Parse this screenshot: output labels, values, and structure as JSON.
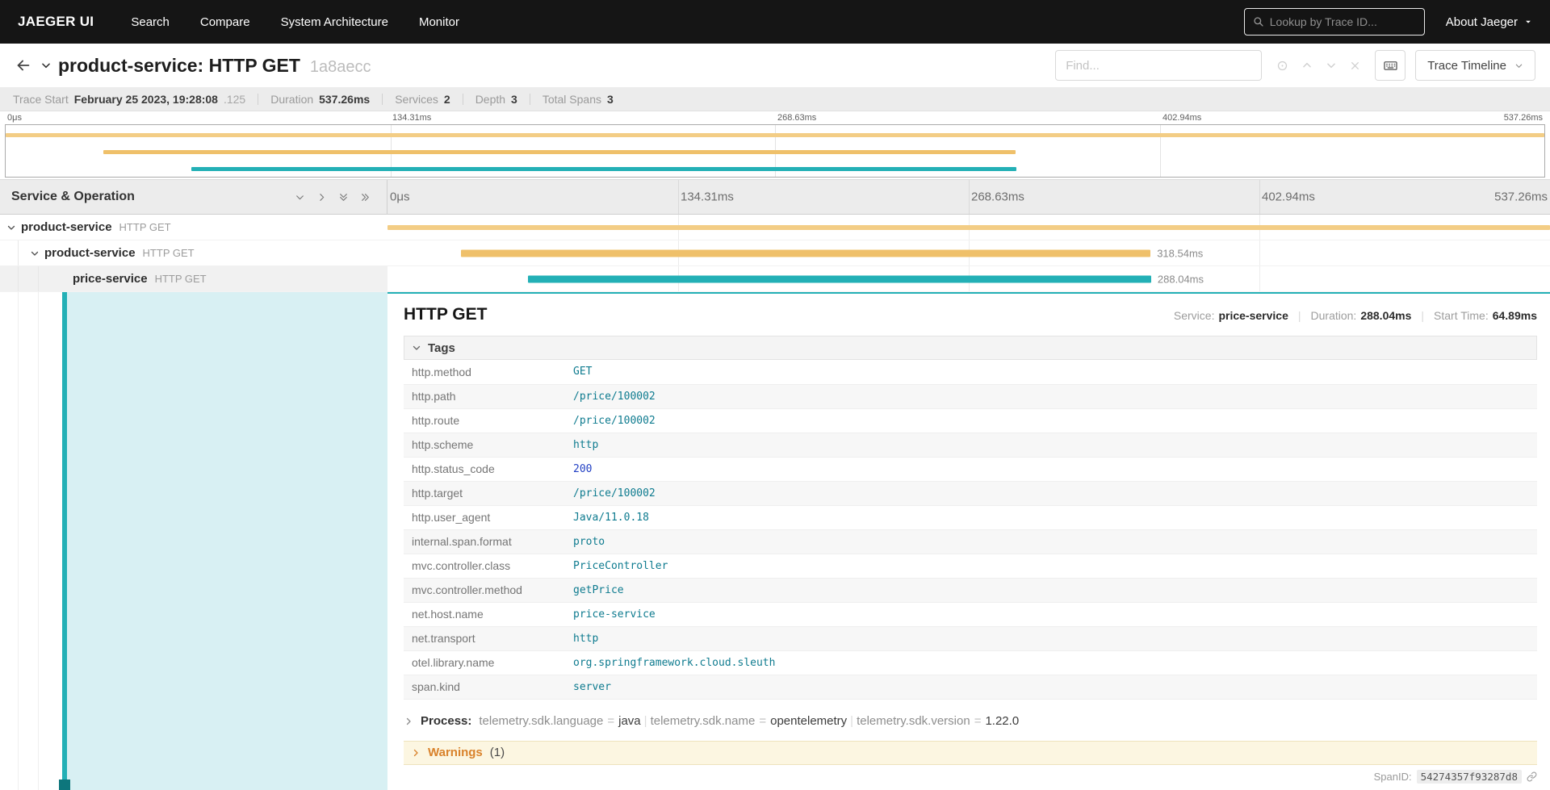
{
  "nav": {
    "brand": "JAEGER UI",
    "items": [
      "Search",
      "Compare",
      "System Architecture",
      "Monitor"
    ],
    "lookup_placeholder": "Lookup by Trace ID...",
    "about_label": "About Jaeger"
  },
  "header": {
    "title": "product-service: HTTP GET",
    "trace_short_id": "1a8aecc",
    "find_placeholder": "Find...",
    "view_label": "Trace Timeline"
  },
  "summary": [
    {
      "label": "Trace Start",
      "value": "February 25 2023, 19:28:08",
      "suffix": ".125"
    },
    {
      "label": "Duration",
      "value": "537.26ms"
    },
    {
      "label": "Services",
      "value": "2"
    },
    {
      "label": "Depth",
      "value": "3"
    },
    {
      "label": "Total Spans",
      "value": "3"
    }
  ],
  "timeline": {
    "left_header": "Service & Operation",
    "ticks": [
      "0μs",
      "134.31ms",
      "268.63ms",
      "402.94ms",
      "537.26ms"
    ]
  },
  "colors": {
    "accent": "#23b0b6",
    "accent_light": "#d8f0f3",
    "accent_dark": "#0d767c",
    "span_root": "#f3cd85",
    "span_product": "#efc06a",
    "span_price": "#23b0b6",
    "warning": "#d9822b",
    "tag_string": "#0e7b8f",
    "tag_number": "#2240c4"
  },
  "spans": [
    {
      "service": "product-service",
      "operation": "HTTP GET",
      "depth": 0,
      "has_children": true,
      "start_pct": 0,
      "width_pct": 100,
      "duration_label": "",
      "color": "span_root",
      "selected": false
    },
    {
      "service": "product-service",
      "operation": "HTTP GET",
      "depth": 1,
      "has_children": true,
      "start_pct": 6.35,
      "width_pct": 59.29,
      "duration_label": "318.54ms",
      "color": "span_product",
      "selected": false
    },
    {
      "service": "price-service",
      "operation": "HTTP GET",
      "depth": 2,
      "has_children": false,
      "start_pct": 12.08,
      "width_pct": 53.61,
      "duration_label": "288.04ms",
      "color": "span_price",
      "selected": true
    }
  ],
  "detail": {
    "operation": "HTTP GET",
    "meta": [
      {
        "label": "Service:",
        "value": "price-service"
      },
      {
        "label": "Duration:",
        "value": "288.04ms"
      },
      {
        "label": "Start Time:",
        "value": "64.89ms"
      }
    ],
    "tags_header": "Tags",
    "tags": [
      {
        "key": "http.method",
        "value": "GET",
        "type": "string"
      },
      {
        "key": "http.path",
        "value": "/price/100002",
        "type": "string"
      },
      {
        "key": "http.route",
        "value": "/price/100002",
        "type": "string"
      },
      {
        "key": "http.scheme",
        "value": "http",
        "type": "string"
      },
      {
        "key": "http.status_code",
        "value": "200",
        "type": "number"
      },
      {
        "key": "http.target",
        "value": "/price/100002",
        "type": "string"
      },
      {
        "key": "http.user_agent",
        "value": "Java/11.0.18",
        "type": "string"
      },
      {
        "key": "internal.span.format",
        "value": "proto",
        "type": "string"
      },
      {
        "key": "mvc.controller.class",
        "value": "PriceController",
        "type": "string"
      },
      {
        "key": "mvc.controller.method",
        "value": "getPrice",
        "type": "string"
      },
      {
        "key": "net.host.name",
        "value": "price-service",
        "type": "string"
      },
      {
        "key": "net.transport",
        "value": "http",
        "type": "string"
      },
      {
        "key": "otel.library.name",
        "value": "org.springframework.cloud.sleuth",
        "type": "string"
      },
      {
        "key": "span.kind",
        "value": "server",
        "type": "string"
      }
    ],
    "process": {
      "label": "Process:",
      "kvs": [
        {
          "key": "telemetry.sdk.language",
          "value": "java"
        },
        {
          "key": "telemetry.sdk.name",
          "value": "opentelemetry"
        },
        {
          "key": "telemetry.sdk.version",
          "value": "1.22.0"
        }
      ]
    },
    "warnings_label": "Warnings",
    "warnings_count": "(1)",
    "span_id_label": "SpanID:",
    "span_id": "54274357f93287d8"
  }
}
